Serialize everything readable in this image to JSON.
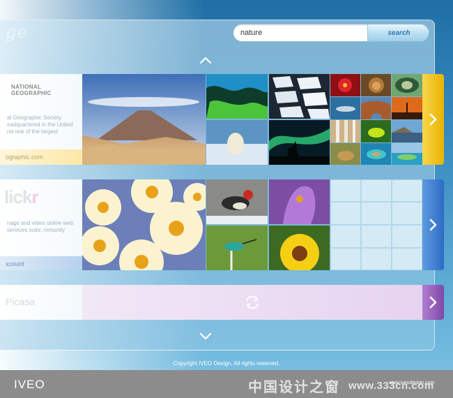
{
  "app": {
    "logo_text": "ge",
    "brand": "IVEO",
    "copyright": "Copyright IVEO Design. All rights reserved."
  },
  "search": {
    "value": "nature",
    "button_label": "search"
  },
  "sources": [
    {
      "name_line1": "NATIONAL",
      "name_line2": "GEOGRAPHIC",
      "description": "al Geographic Society eadquartered in the United nd one of the largest",
      "link": "ographic.com",
      "tab_color": "#e8b300"
    },
    {
      "name_prefix": "lick",
      "name_suffix": "r",
      "description": "nage and video online web services suite, mmunity",
      "link": "xcount",
      "tab_color": "#2d6bc6"
    },
    {
      "name": "Picasa",
      "tab_color": "#7f48a8"
    }
  ],
  "thumbnail_subjects": {
    "natgeo": [
      "volcano-landscape",
      "iceberg-aerial",
      "ice-floes",
      "red-flower",
      "lion",
      "eye-nebula",
      "polar-bear",
      "aurora-deer",
      "shark",
      "rock-arch",
      "sunset-giraffe",
      "birch-trees",
      "frog",
      "coast",
      "leopard",
      "lagoon",
      "reef-island"
    ],
    "flickr": [
      "daisies",
      "woodpecker",
      "crocus-bee",
      "hummingbird",
      "yellow-daisy"
    ]
  },
  "watermark": {
    "cn": "中国设计之窗",
    "url": "www.333cn.com",
    "small": "www.iveodesign.com"
  }
}
